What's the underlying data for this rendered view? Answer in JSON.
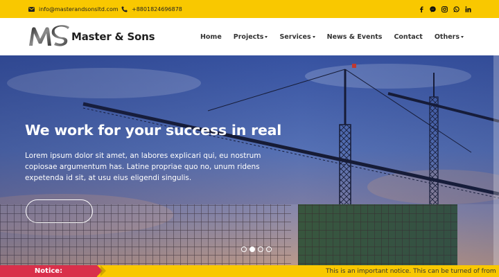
{
  "topbar": {
    "email": "info@masterandsonsltd.com",
    "phone": "+8801824696878",
    "email_icon": "envelope-icon",
    "phone_icon": "phone-icon",
    "socials": [
      "facebook-icon",
      "messenger-icon",
      "instagram-icon",
      "whatsapp-icon",
      "linkedin-icon"
    ],
    "background": "#f9c800"
  },
  "header": {
    "logo_mark": "MS",
    "logo_text": "Master & Sons",
    "nav": [
      {
        "label": "Home",
        "dropdown": false
      },
      {
        "label": "Projects",
        "dropdown": true
      },
      {
        "label": "Services",
        "dropdown": true
      },
      {
        "label": "News & Events",
        "dropdown": false
      },
      {
        "label": "Contact",
        "dropdown": false
      },
      {
        "label": "Others",
        "dropdown": true
      }
    ]
  },
  "hero": {
    "title": "We work for your success in real",
    "text": "Lorem ipsum dolor sit amet, an labores explicari qui, eu nostrum copiosae argumentum has. Latine propriae quo no, unum ridens expetenda id sit, at usu eius eligendi singulis.",
    "slide_count": 4,
    "active_slide": 2
  },
  "notice": {
    "label": "Notice:",
    "text": "This is an important notice. This can be turned of from",
    "label_color": "#d9304a"
  }
}
